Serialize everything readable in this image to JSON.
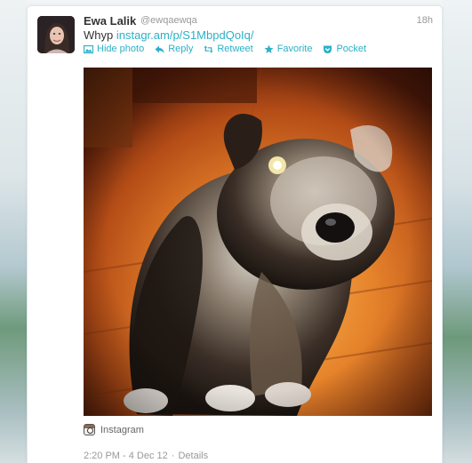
{
  "tweet": {
    "fullname": "Ewa Lalik",
    "screen_name": "@ewqaewqa",
    "time_ago": "18h",
    "text_prefix": "Whyp",
    "link": "instagr.am/p/S1MbpdQoIq/",
    "actions": {
      "hide_photo": "Hide photo",
      "reply": "Reply",
      "retweet": "Retweet",
      "favorite": "Favorite",
      "pocket": "Pocket"
    },
    "media_source": "Instagram",
    "footer": {
      "datetime": "2:20 PM - 4 Dec 12",
      "separator": "·",
      "details": "Details"
    }
  },
  "icons": {
    "hide_photo": "photo-icon",
    "reply": "reply-arrow-icon",
    "retweet": "retweet-icon",
    "favorite": "star-icon",
    "pocket": "pocket-icon",
    "media_source": "instagram-icon"
  },
  "colors": {
    "link": "#2bb0c7",
    "name": "#333333",
    "muted": "#999999"
  }
}
